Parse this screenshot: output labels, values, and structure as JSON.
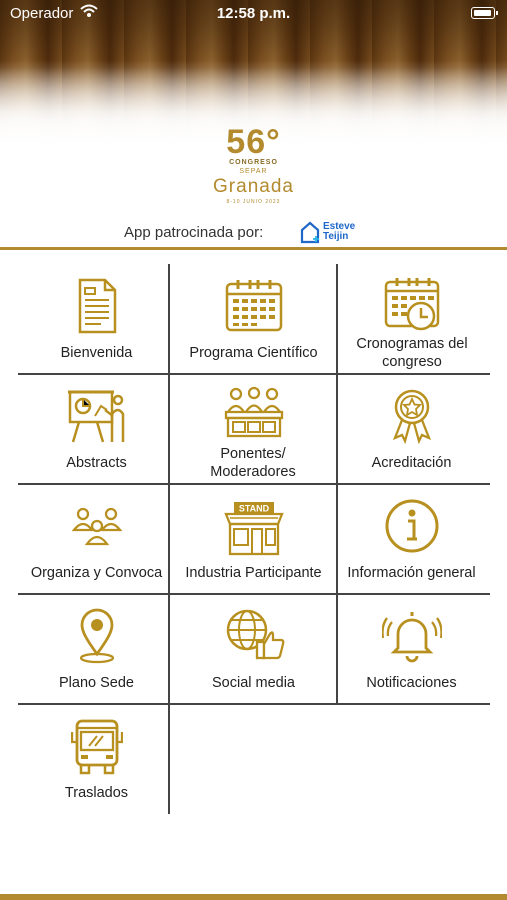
{
  "status_bar": {
    "carrier": "Operador",
    "time": "12:58 p.m."
  },
  "logo": {
    "number": "56°",
    "line1": "CONGRESO",
    "line2": "SEPAR",
    "city": "Granada",
    "dates": "8-10 JUNIO 2023"
  },
  "sponsor": {
    "label": "App patrocinada por:",
    "brand_line1": "Esteve",
    "brand_line2": "Teijin"
  },
  "colors": {
    "gold": "#b28a2f",
    "icon_gold": "#b8901f",
    "brand_blue": "#1f67c9"
  },
  "menu": [
    {
      "label": "Bienvenida",
      "icon": "document-icon"
    },
    {
      "label": "Programa Científico",
      "icon": "calendar-icon"
    },
    {
      "label": "Cronogramas del congreso",
      "icon": "calendar-clock-icon"
    },
    {
      "label": "Abstracts",
      "icon": "presentation-icon"
    },
    {
      "label": "Ponentes/ Moderadores",
      "icon": "panel-speakers-icon"
    },
    {
      "label": "Acreditación",
      "icon": "award-badge-icon"
    },
    {
      "label": "Organiza y Convoca",
      "icon": "group-people-icon"
    },
    {
      "label": "Industria Participante",
      "icon": "stand-shop-icon"
    },
    {
      "label": "Información general",
      "icon": "info-icon"
    },
    {
      "label": "Plano Sede",
      "icon": "map-pin-icon"
    },
    {
      "label": "Social media",
      "icon": "globe-like-icon"
    },
    {
      "label": "Notificaciones",
      "icon": "bell-icon"
    },
    {
      "label": "Traslados",
      "icon": "bus-icon"
    }
  ],
  "menu_sign": "STAND"
}
